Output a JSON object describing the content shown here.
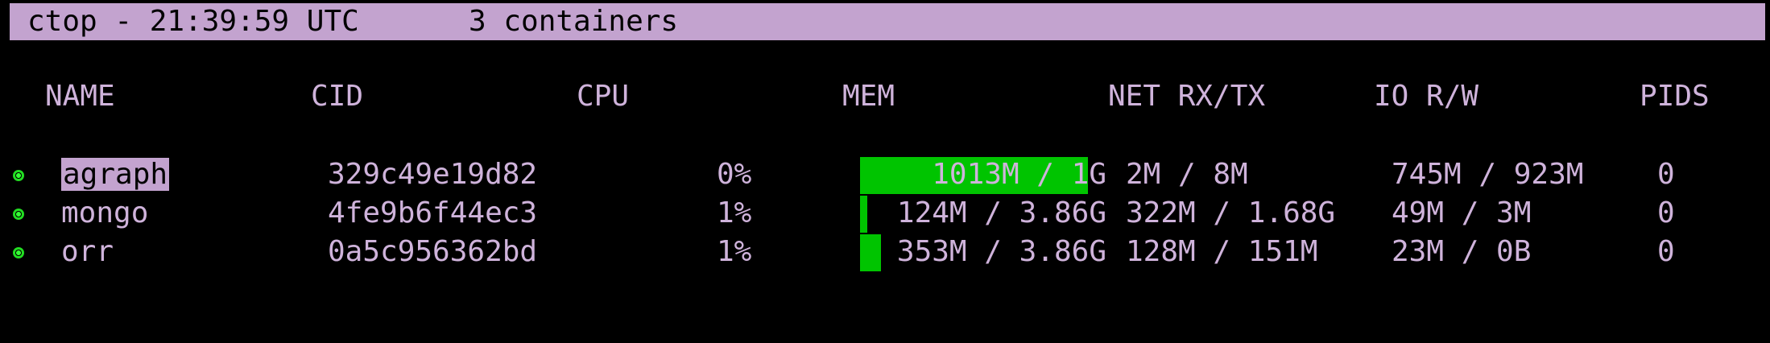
{
  "header": {
    "title": "ctop - 21:39:59 UTC",
    "container_count": "3 containers"
  },
  "columns": {
    "name": "NAME",
    "cid": "CID",
    "cpu": "CPU",
    "mem": "MEM",
    "net": "NET RX/TX",
    "io": "IO R/W",
    "pids": "PIDS"
  },
  "colors": {
    "header_bg": "#c3a3cf",
    "text": "#cfb3db",
    "mem_bar": "#00c400",
    "status_running": "#22dd22"
  },
  "containers": [
    {
      "name": "agraph",
      "cid": "329c49e19d82",
      "cpu": "0%",
      "mem": "1013M / 1G",
      "mem_fraction": 0.99,
      "net": "2M / 8M",
      "io": "745M / 923M",
      "pids": "0",
      "selected": true
    },
    {
      "name": "mongo",
      "cid": "4fe9b6f44ec3",
      "cpu": "1%",
      "mem": "124M / 3.86G",
      "mem_fraction": 0.03,
      "net": "322M / 1.68G",
      "io": "49M / 3M",
      "pids": "0",
      "selected": false
    },
    {
      "name": "orr",
      "cid": "0a5c956362bd",
      "cpu": "1%",
      "mem": "353M / 3.86G",
      "mem_fraction": 0.09,
      "net": "128M / 151M",
      "io": "23M / 0B",
      "pids": "0",
      "selected": false
    }
  ]
}
